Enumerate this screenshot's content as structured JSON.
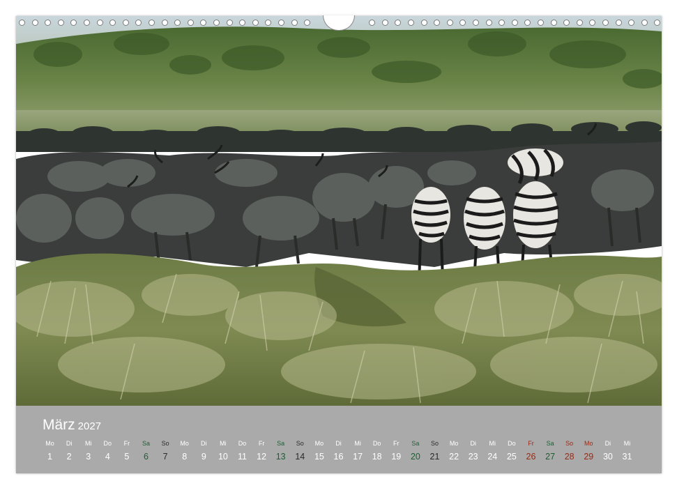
{
  "calendar": {
    "month": "März",
    "year": "2027",
    "colors": {
      "weekday": "#ffffff",
      "saturday": "#1f5e35",
      "sunday": "#2b2b2b",
      "holiday": "#9a2a16",
      "strip": "#aaaaaa"
    },
    "days": [
      {
        "wd": "Mo",
        "d": "1",
        "type": "weekday"
      },
      {
        "wd": "Di",
        "d": "2",
        "type": "weekday"
      },
      {
        "wd": "Mi",
        "d": "3",
        "type": "weekday"
      },
      {
        "wd": "Do",
        "d": "4",
        "type": "weekday"
      },
      {
        "wd": "Fr",
        "d": "5",
        "type": "weekday"
      },
      {
        "wd": "Sa",
        "d": "6",
        "type": "sat"
      },
      {
        "wd": "So",
        "d": "7",
        "type": "sun"
      },
      {
        "wd": "Mo",
        "d": "8",
        "type": "weekday"
      },
      {
        "wd": "Di",
        "d": "9",
        "type": "weekday"
      },
      {
        "wd": "Mi",
        "d": "10",
        "type": "weekday"
      },
      {
        "wd": "Do",
        "d": "11",
        "type": "weekday"
      },
      {
        "wd": "Fr",
        "d": "12",
        "type": "weekday"
      },
      {
        "wd": "Sa",
        "d": "13",
        "type": "sat"
      },
      {
        "wd": "So",
        "d": "14",
        "type": "sun"
      },
      {
        "wd": "Mo",
        "d": "15",
        "type": "weekday"
      },
      {
        "wd": "Di",
        "d": "16",
        "type": "weekday"
      },
      {
        "wd": "Mi",
        "d": "17",
        "type": "weekday"
      },
      {
        "wd": "Do",
        "d": "18",
        "type": "weekday"
      },
      {
        "wd": "Fr",
        "d": "19",
        "type": "weekday"
      },
      {
        "wd": "Sa",
        "d": "20",
        "type": "sat"
      },
      {
        "wd": "So",
        "d": "21",
        "type": "sun"
      },
      {
        "wd": "Mo",
        "d": "22",
        "type": "weekday"
      },
      {
        "wd": "Di",
        "d": "23",
        "type": "weekday"
      },
      {
        "wd": "Mi",
        "d": "24",
        "type": "weekday"
      },
      {
        "wd": "Do",
        "d": "25",
        "type": "weekday"
      },
      {
        "wd": "Fr",
        "d": "26",
        "type": "hol"
      },
      {
        "wd": "Sa",
        "d": "27",
        "type": "sat"
      },
      {
        "wd": "So",
        "d": "28",
        "type": "hol"
      },
      {
        "wd": "Mo",
        "d": "29",
        "type": "hol"
      },
      {
        "wd": "Di",
        "d": "30",
        "type": "weekday"
      },
      {
        "wd": "Mi",
        "d": "31",
        "type": "weekday"
      }
    ]
  },
  "photo": {
    "subject": "wildebeest-and-zebra-herd-in-grassland"
  }
}
